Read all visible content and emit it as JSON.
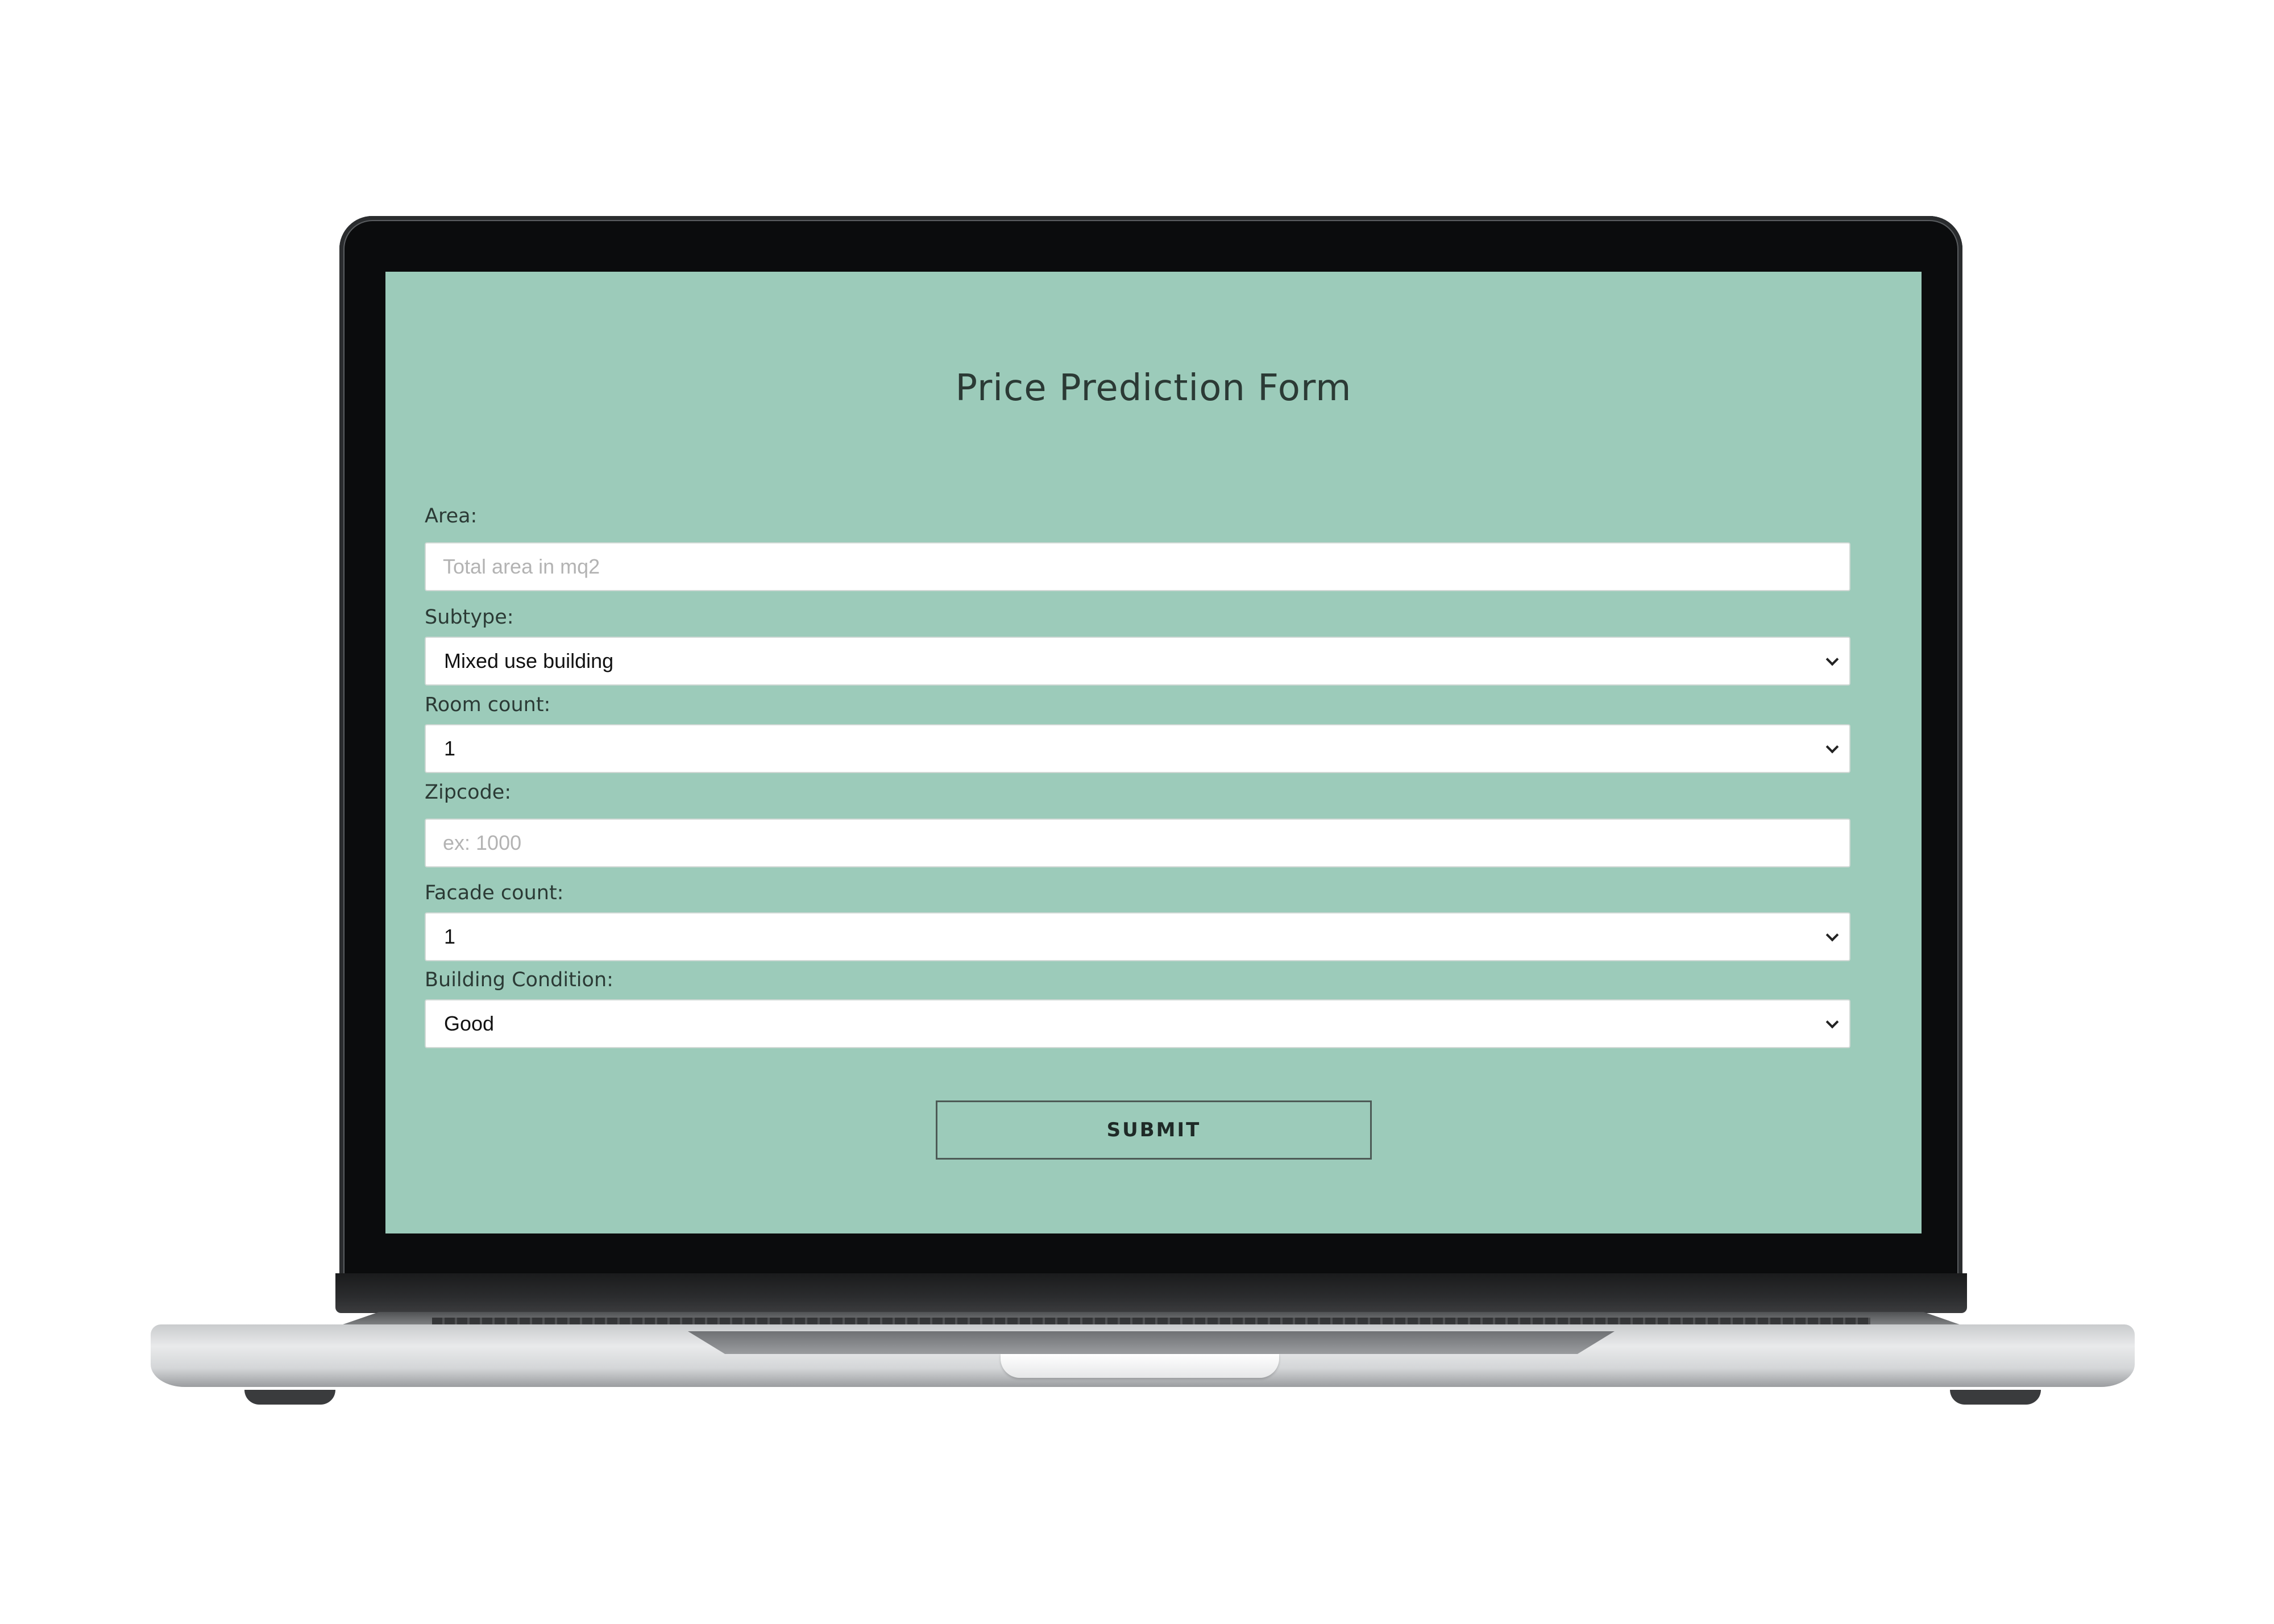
{
  "form": {
    "title": "Price Prediction Form",
    "area": {
      "label": "Area:",
      "value": "",
      "placeholder": "Total area in mq2"
    },
    "subtype": {
      "label": "Subtype:",
      "selected": "Mixed use building"
    },
    "room_count": {
      "label": "Room count:",
      "selected": "1"
    },
    "zipcode": {
      "label": "Zipcode:",
      "value": "",
      "placeholder": "ex: 1000"
    },
    "facade_count": {
      "label": "Facade count:",
      "selected": "1"
    },
    "building_condition": {
      "label": "Building Condition:",
      "selected": "Good"
    },
    "submit_label": "SUBMIT"
  },
  "colors": {
    "screen_background": "#9ccbba",
    "text": "#2b3a35",
    "field_background": "#ffffff",
    "placeholder": "#b3b3b3"
  },
  "icons": {
    "select_arrow": "chevron-down-icon"
  }
}
